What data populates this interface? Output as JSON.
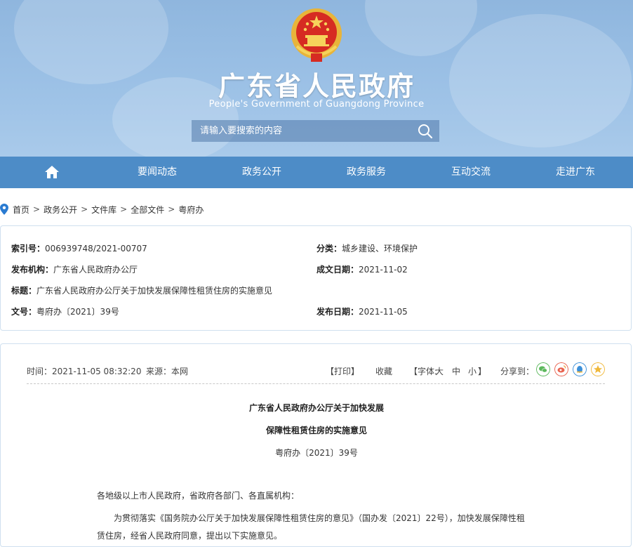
{
  "header": {
    "title": "广东省人民政府",
    "subtitle": "People's Government of Guangdong Province",
    "search_placeholder": "请输入要搜索的内容"
  },
  "nav": {
    "home_icon": "home-icon",
    "items": [
      "要闻动态",
      "政务公开",
      "政务服务",
      "互动交流",
      "走进广东"
    ]
  },
  "breadcrumb": [
    "首页",
    "政务公开",
    "文件库",
    "全部文件",
    "粤府办"
  ],
  "meta": {
    "index_label": "索引号：",
    "index_value": "006939748/2021-00707",
    "category_label": "分类：",
    "category_value": "城乡建设、环境保护",
    "publisher_label": "发布机构：",
    "publisher_value": "广东省人民政府办公厅",
    "written_label": "成文日期：",
    "written_value": "2021-11-02",
    "title_label": "标题：",
    "title_value": "广东省人民政府办公厅关于加快发展保障性租赁住房的实施意见",
    "docno_label": "文号：",
    "docno_value": "粤府办〔2021〕39号",
    "pubdate_label": "发布日期：",
    "pubdate_value": "2021-11-05"
  },
  "article": {
    "time": "时间：2021-11-05 08:32:20",
    "source": "来源：本网",
    "print": "【打印】",
    "favorite": "收藏",
    "font_label": "【字体:",
    "font_large": "大",
    "font_medium": "中",
    "font_small": "小",
    "font_close": "】",
    "share_label": "分享到：",
    "title_line1": "广东省人民政府办公厅关于加快发展",
    "title_line2": "保障性租赁住房的实施意见",
    "doc_number": "粤府办〔2021〕39号",
    "salutation": "各地级以上市人民政府，省政府各部门、各直属机构：",
    "body_line1": "为贯彻落实《国务院办公厅关于加快发展保障性租赁住房的意见》（国办发〔2021〕22号），加快发展保障性租",
    "body_line2": "赁住房，经省人民政府同意，提出以下实施意见。"
  },
  "colors": {
    "banner": "#9cc1e6",
    "nav": "#4d8cc7",
    "border": "#cfe0ef",
    "wechat": "#5cb85c",
    "weibo": "#e8624f",
    "qq": "#3b8fd9",
    "qzone": "#f0b83a"
  }
}
